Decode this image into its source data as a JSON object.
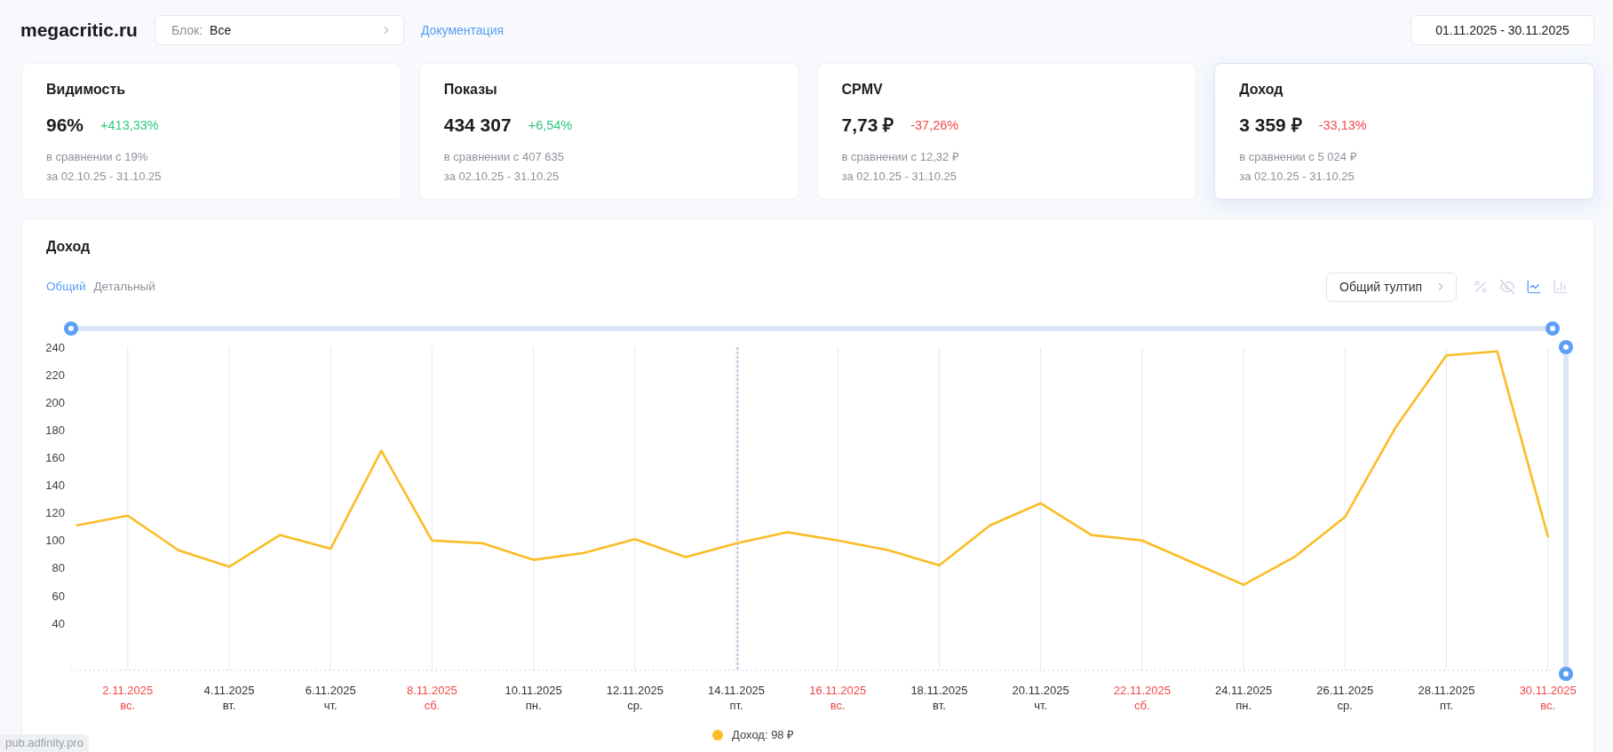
{
  "site_title": "megacritic.ru",
  "block_select": {
    "label": "Блок:",
    "value": "Все"
  },
  "docs_link": "Документация",
  "date_range": "01.11.2025 - 30.11.2025",
  "cards": [
    {
      "title": "Видимость",
      "value": "96%",
      "change": "+413,33%",
      "color": "#2fc77a",
      "comparison": "в сравнении с 19%",
      "period": "за 02.10.25 - 31.10.25",
      "selected": false
    },
    {
      "title": "Показы",
      "value": "434 307",
      "change": "+6,54%",
      "color": "#2fc77a",
      "comparison": "в сравнении с 407 635",
      "period": "за 02.10.25 - 31.10.25",
      "selected": false
    },
    {
      "title": "CPMV",
      "value": "7,73 ₽",
      "change": "-37,26%",
      "color": "#f04848",
      "comparison": "в сравнении с 12,32 ₽",
      "period": "за 02.10.25 - 31.10.25",
      "selected": false
    },
    {
      "title": "Доход",
      "value": "3 359 ₽",
      "change": "-33,13%",
      "color": "#f04848",
      "comparison": "в сравнении с 5 024 ₽",
      "period": "за 02.10.25 - 31.10.25",
      "selected": true
    }
  ],
  "chart": {
    "title": "Доход",
    "tabs": [
      {
        "label": "Общий",
        "selected": true
      },
      {
        "label": "Детальный",
        "selected": false
      }
    ],
    "tooltip_select": {
      "value": "Общий тултип"
    },
    "view_buttons": [
      {
        "kind": "percent",
        "selected": false
      },
      {
        "kind": "hide",
        "selected": false
      },
      {
        "kind": "line",
        "selected": true
      },
      {
        "kind": "bar",
        "selected": false
      }
    ],
    "x_zoom": {
      "level": 1
    },
    "y_zoom": {
      "level": 1
    },
    "chart_data": {
      "type": "line",
      "categories": [
        null,
        "2.11.2025",
        null,
        "4.11.2025",
        null,
        "6.11.2025",
        null,
        "8.11.2025",
        null,
        "10.11.2025",
        null,
        "12.11.2025",
        null,
        "14.11.2025",
        null,
        "16.11.2025",
        null,
        "18.11.2025",
        null,
        "20.11.2025",
        null,
        "22.11.2025",
        null,
        "24.11.2025",
        null,
        "26.11.2025",
        null,
        "28.11.2025",
        null,
        "30.11.2025"
      ],
      "series": [
        {
          "color": "#fbbc25",
          "values": [
            111,
            118,
            93,
            81,
            104,
            94,
            165,
            100,
            98,
            86,
            91,
            101,
            88,
            98,
            106,
            100,
            93,
            82,
            111,
            127,
            104,
            100,
            84,
            68,
            88,
            117,
            182,
            234,
            237,
            103
          ]
        }
      ],
      "ylim": [
        6,
        240
      ],
      "yticks": [
        40,
        60,
        80,
        100,
        120,
        140,
        160,
        180,
        200,
        220,
        240
      ],
      "grid": true,
      "ref_lines": [
        {
          "axis": "x",
          "value": "14.11.2025"
        }
      ]
    },
    "x_axis_weekdays": [
      {
        "label": "вс.",
        "weekend": true
      },
      {
        "label": "вт.",
        "weekend": false
      },
      {
        "label": "чт.",
        "weekend": false
      },
      {
        "label": "сб.",
        "weekend": true
      },
      {
        "label": "пн.",
        "weekend": false
      },
      {
        "label": "ср.",
        "weekend": false
      },
      {
        "label": "пт.",
        "weekend": false
      },
      {
        "label": "вс.",
        "weekend": true
      },
      {
        "label": "вт.",
        "weekend": false
      },
      {
        "label": "чт.",
        "weekend": false
      },
      {
        "label": "сб.",
        "weekend": true
      },
      {
        "label": "пн.",
        "weekend": false
      },
      {
        "label": "ср.",
        "weekend": false
      },
      {
        "label": "пт.",
        "weekend": false
      },
      {
        "label": "вс.",
        "weekend": true
      }
    ],
    "legend": {
      "label": "Доход: 98 ₽"
    }
  },
  "status_bar": {
    "url": "pub.adfinity.pro"
  }
}
